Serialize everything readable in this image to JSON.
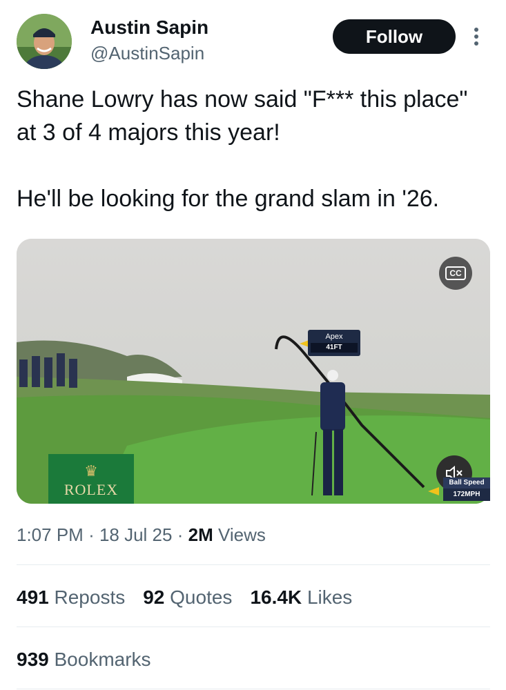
{
  "author": {
    "name": "Austin Sapin",
    "handle": "@AustinSapin",
    "follow_label": "Follow"
  },
  "tweet": {
    "line1": "Shane Lowry has now said \"F*** this place\" at 3 of 4 majors this year!",
    "line2": "He'll be looking for the grand slam in '26."
  },
  "video": {
    "cc_label": "CC",
    "apex_label": "Apex",
    "apex_value": "41FT",
    "ball_speed_label": "Ball Speed",
    "ball_speed_value": "172MPH",
    "sponsor": "ROLEX"
  },
  "meta": {
    "time": "1:07 PM",
    "date": "18 Jul 25",
    "views_count": "2M",
    "views_label": "Views"
  },
  "stats": {
    "reposts_count": "491",
    "reposts_label": "Reposts",
    "quotes_count": "92",
    "quotes_label": "Quotes",
    "likes_count": "16.4K",
    "likes_label": "Likes",
    "bookmarks_count": "939",
    "bookmarks_label": "Bookmarks"
  }
}
